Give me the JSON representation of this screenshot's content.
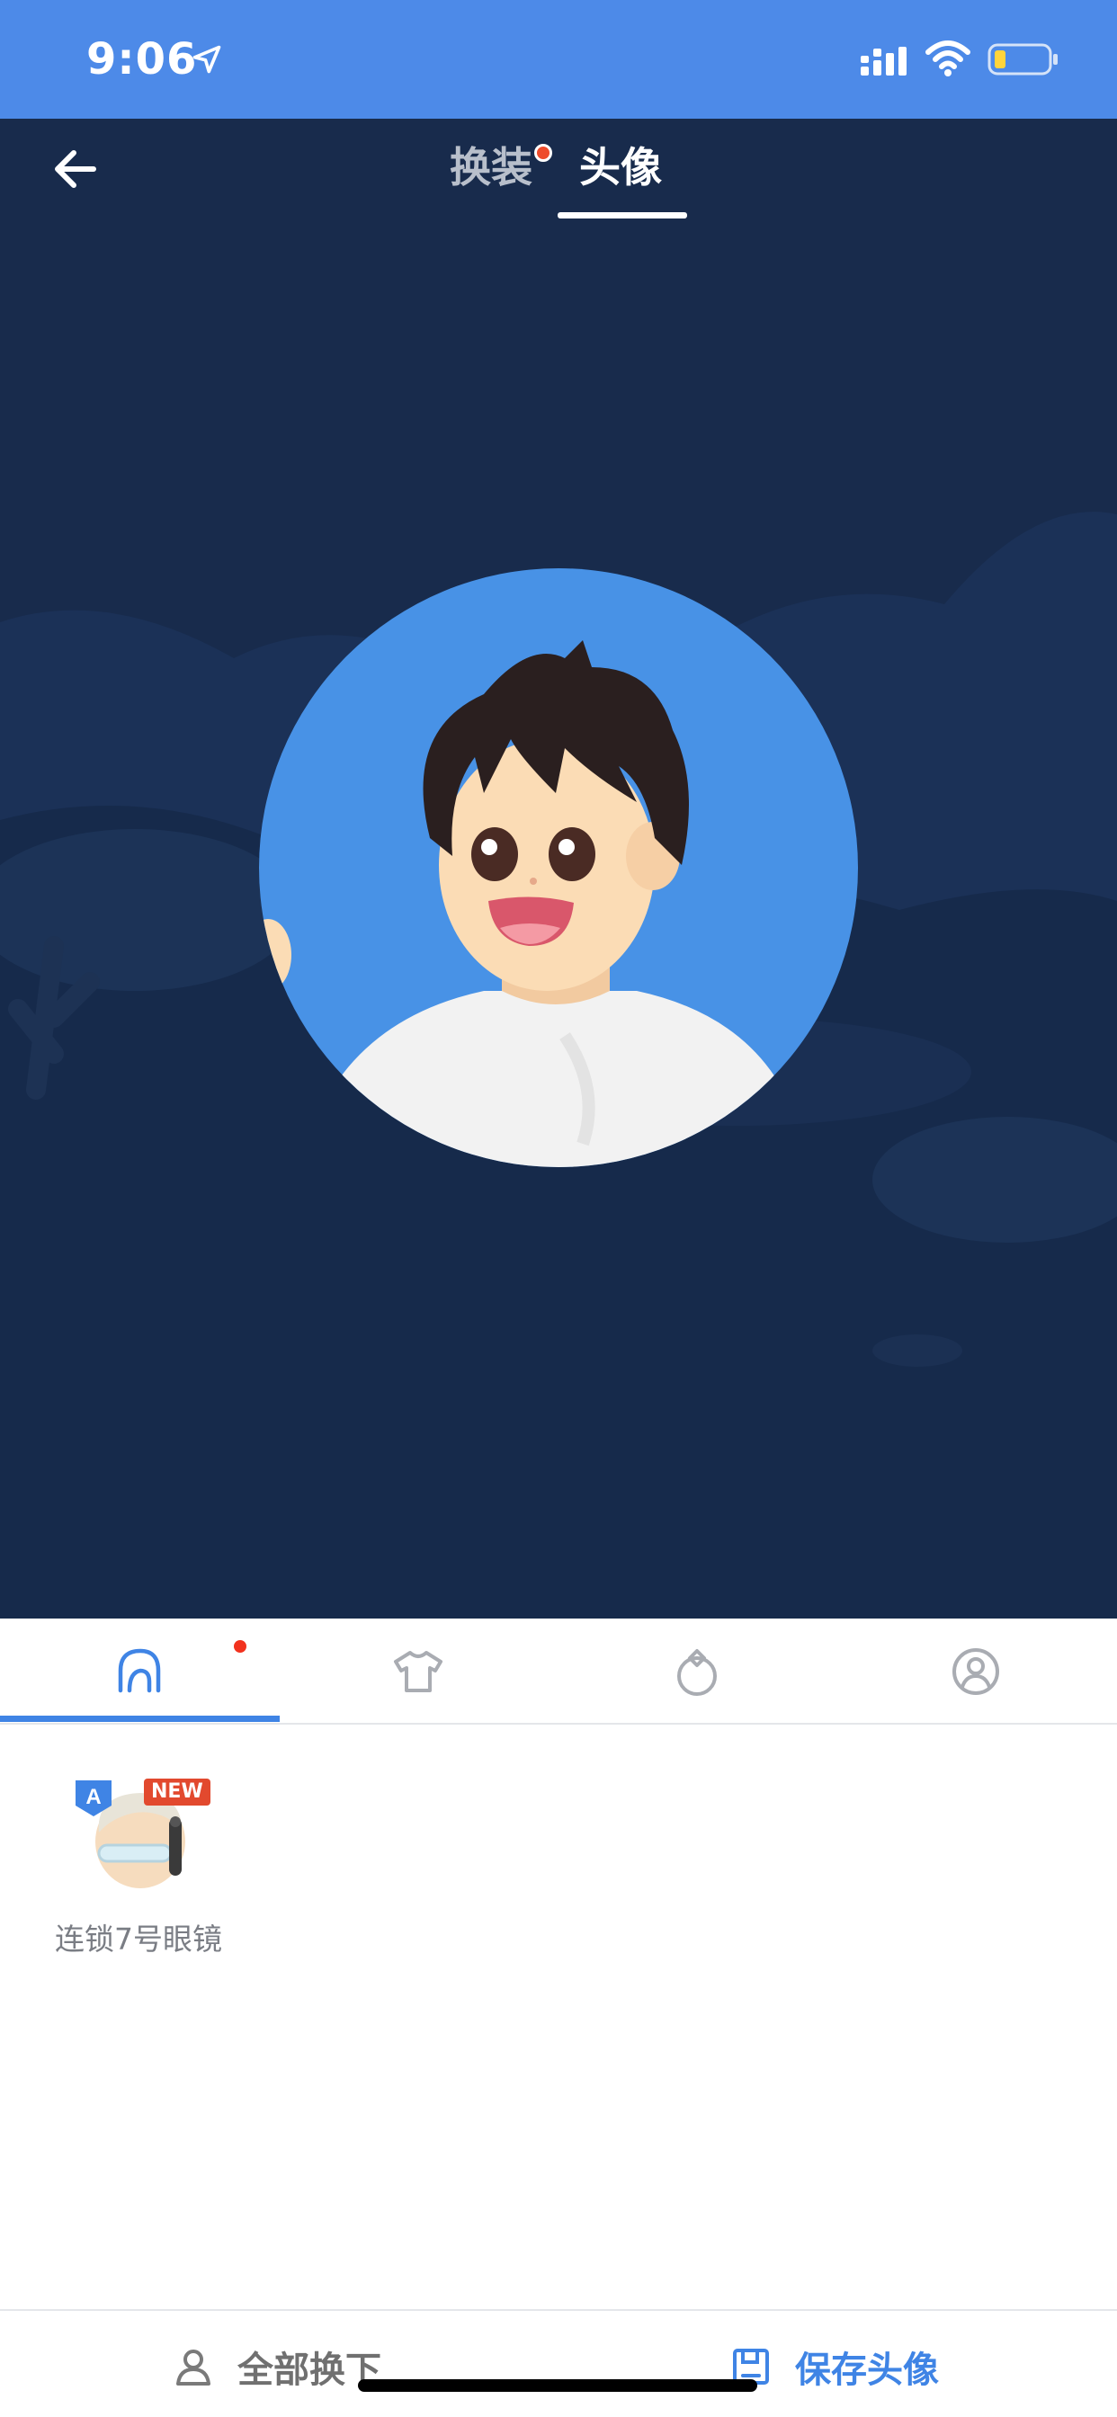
{
  "status_bar": {
    "time": "9:06",
    "icons": [
      "location-arrow-icon",
      "signal-icon",
      "wifi-icon",
      "battery-icon"
    ],
    "background": "#4d8ae8"
  },
  "header": {
    "back_icon": "arrow-left-icon",
    "tabs": [
      {
        "label": "换装",
        "active": false,
        "has_dot": true
      },
      {
        "label": "头像",
        "active": true,
        "has_dot": false
      }
    ]
  },
  "stage": {
    "background": "#182b4c",
    "avatar_circle_color": "#4892e6"
  },
  "categories": {
    "items": [
      {
        "icon": "hair-icon",
        "active": true,
        "has_dot": true
      },
      {
        "icon": "shirt-icon",
        "active": false,
        "has_dot": false
      },
      {
        "icon": "accessory-icon",
        "active": false,
        "has_dot": false
      },
      {
        "icon": "profile-frame-icon",
        "active": false,
        "has_dot": false
      }
    ],
    "accent": "#3f84e5"
  },
  "items": [
    {
      "name": "连锁7号眼镜",
      "badge_letter": "A",
      "badge_new": "NEW"
    }
  ],
  "actions": {
    "remove_all": {
      "label": "全部换下",
      "icon": "person-outline-icon"
    },
    "save": {
      "label": "保存头像",
      "icon": "save-icon"
    }
  }
}
